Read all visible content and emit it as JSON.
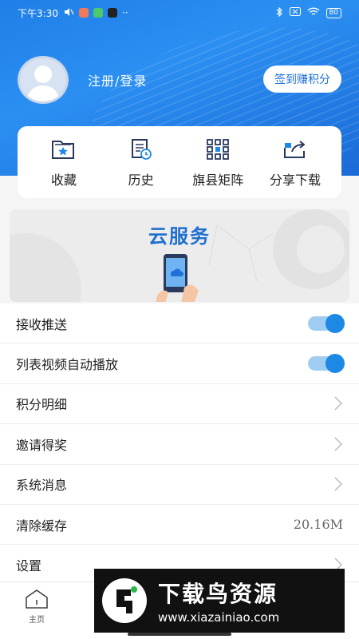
{
  "status_bar": {
    "time": "下午3:30",
    "battery": "80",
    "more": "··"
  },
  "profile": {
    "login_label": "注册/登录",
    "signin_button": "签到赚积分"
  },
  "quick_actions": [
    {
      "label": "收藏",
      "icon": "favorites-folder-icon"
    },
    {
      "label": "历史",
      "icon": "history-document-icon"
    },
    {
      "label": "旗县矩阵",
      "icon": "matrix-grid-icon"
    },
    {
      "label": "分享下载",
      "icon": "share-icon"
    }
  ],
  "banner": {
    "title": "云服务"
  },
  "settings": [
    {
      "label": "接收推送",
      "type": "toggle",
      "on": true
    },
    {
      "label": "列表视频自动播放",
      "type": "toggle",
      "on": true
    },
    {
      "label": "积分明细",
      "type": "link"
    },
    {
      "label": "邀请得奖",
      "type": "link"
    },
    {
      "label": "系统消息",
      "type": "link"
    },
    {
      "label": "清除缓存",
      "type": "value",
      "value": "20.16M"
    },
    {
      "label": "设置",
      "type": "link"
    }
  ],
  "bottom_nav": {
    "home_label": "主页"
  },
  "watermark": {
    "title": "下载鸟资源",
    "url": "www.xiazainiao.com"
  },
  "colors": {
    "header_blue": "#1f7fe8",
    "toggle_on": "#1e88e5",
    "toggle_track": "#9fcdf2",
    "banner_title": "#1f6fcf"
  }
}
